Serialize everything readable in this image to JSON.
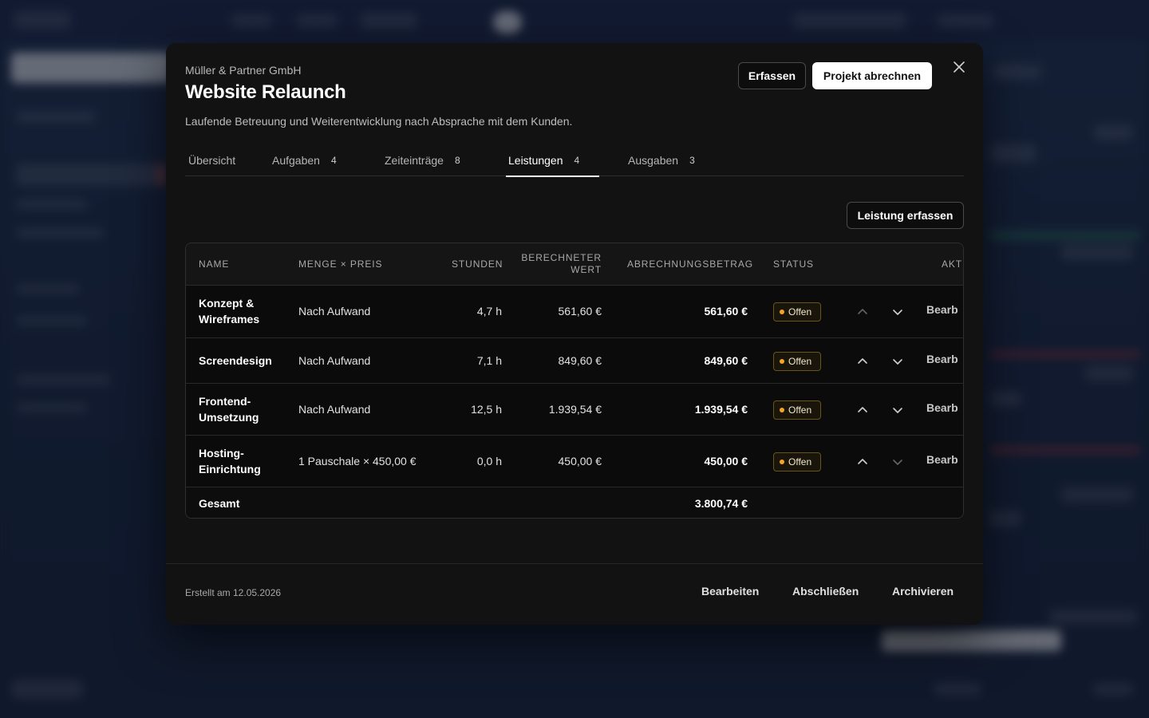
{
  "modal": {
    "client": "Müller & Partner GmbH",
    "title": "Website Relaunch",
    "description": "Laufende Betreuung und Weiterentwicklung nach Absprache mit dem Kunden.",
    "capture_label": "Erfassen",
    "bill_label": "Projekt abrechnen",
    "close_icon": "close-icon"
  },
  "tabs": [
    {
      "label": "Übersicht",
      "count": ""
    },
    {
      "label": "Aufgaben",
      "count": "4"
    },
    {
      "label": "Zeiteinträge",
      "count": "8"
    },
    {
      "label": "Leistungen",
      "count": "4",
      "active": true
    },
    {
      "label": "Ausgaben",
      "count": "3"
    }
  ],
  "add_service_label": "Leistung erfassen",
  "table": {
    "headers": {
      "name": "NAME",
      "qty_price": "MENGE × PREIS",
      "hours": "STUNDEN",
      "calc_value_1": "BERECHNETER",
      "calc_value_2": "WERT",
      "billing_amount": "ABRECHNUNGSBETRAG",
      "status": "STATUS",
      "actions": "AKT"
    },
    "rows": [
      {
        "name_1": "Konzept &",
        "name_2": "Wireframes",
        "qty_price": "Nach Aufwand",
        "hours": "4,7 h",
        "calc_value": "561,60 €",
        "billing_amount": "561,60 €",
        "status": "Offen",
        "edit": "Bearb"
      },
      {
        "name_1": "Screendesign",
        "name_2": "",
        "qty_price": "Nach Aufwand",
        "hours": "7,1 h",
        "calc_value": "849,60 €",
        "billing_amount": "849,60 €",
        "status": "Offen",
        "edit": "Bearb"
      },
      {
        "name_1": "Frontend-",
        "name_2": "Umsetzung",
        "qty_price": "Nach Aufwand",
        "hours": "12,5 h",
        "calc_value": "1.939,54 €",
        "billing_amount": "1.939,54 €",
        "status": "Offen",
        "edit": "Bearb"
      },
      {
        "name_1": "Hosting-",
        "name_2": "Einrichtung",
        "qty_price": "1 Pauschale × 450,00 €",
        "hours": "0,0 h",
        "calc_value": "450,00 €",
        "billing_amount": "450,00 €",
        "status": "Offen",
        "edit": "Bearb"
      }
    ],
    "total_label": "Gesamt",
    "total_amount": "3.800,74 €"
  },
  "footer": {
    "created": "Erstellt am 12.05.2026",
    "edit_label": "Bearbeiten",
    "complete_label": "Abschließen",
    "archive_label": "Archivieren"
  },
  "colors": {
    "status_dot": "#f5a623",
    "modal_bg": "#121212",
    "backdrop": "#162238"
  }
}
